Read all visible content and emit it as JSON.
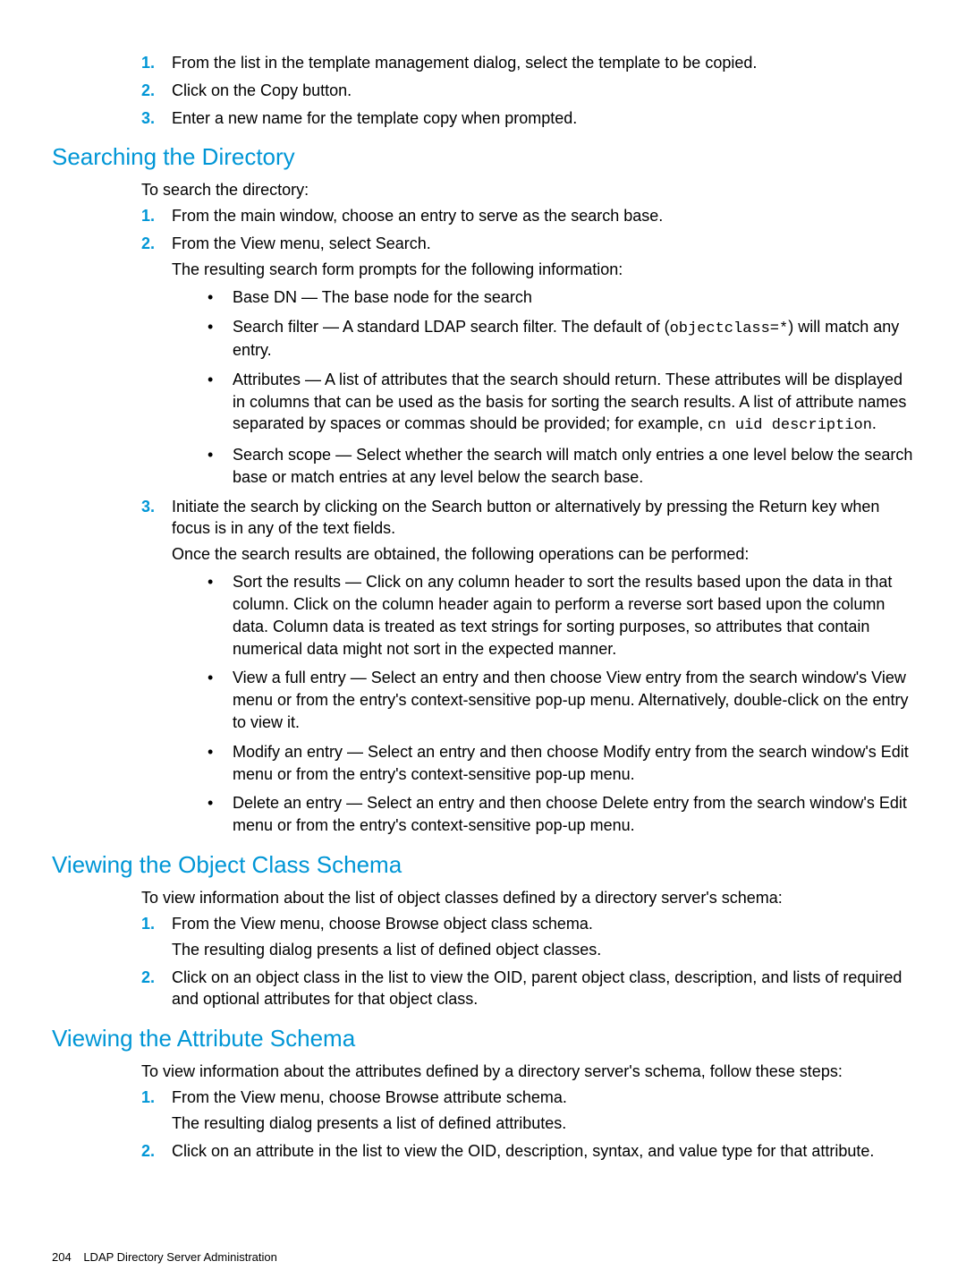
{
  "top_list": [
    {
      "n": "1.",
      "text": "From the list in the template management dialog, select the template to be copied."
    },
    {
      "n": "2.",
      "text": "Click on the Copy button."
    },
    {
      "n": "3.",
      "text": "Enter a new name for the template copy when prompted."
    }
  ],
  "s1": {
    "heading": "Searching the Directory",
    "intro": "To search the directory:",
    "items": [
      {
        "n": "1.",
        "text": "From the main window, choose an entry to serve as the search base."
      },
      {
        "n": "2.",
        "text": "From the View menu, select Search.",
        "after": "The resulting search form prompts for the following information:",
        "bullets": [
          {
            "pre": "Base DN — The base node for the search"
          },
          {
            "pre": "Search filter — A standard LDAP search filter. The default of (",
            "code": "objectclass=*",
            "post": ") will match any entry."
          },
          {
            "pre": "Attributes — A list of attributes that the search should return. These attributes will be displayed in columns that can be used as the basis for sorting the search results. A list of attribute names separated by spaces or commas should be provided; for example, ",
            "code": "cn uid description",
            "post": "."
          },
          {
            "pre": "Search scope — Select whether the search will match only entries a one level below the search base or match entries at any level below the search base."
          }
        ]
      },
      {
        "n": "3.",
        "text": "Initiate the search by clicking on the Search button or alternatively by pressing the Return key when focus is in any of the text fields.",
        "after": "Once the search results are obtained, the following operations can be performed:",
        "bullets": [
          {
            "pre": "Sort the results — Click on any column header to sort the results based upon the data in that column. Click on the column header again to perform a reverse sort based upon the column data. Column data is treated as text strings for sorting purposes, so attributes that contain numerical data might not sort in the expected manner."
          },
          {
            "pre": "View a full entry — Select an entry and then choose View entry from the search window's View menu or from the entry's context-sensitive pop-up menu. Alternatively, double-click on the entry to view it."
          },
          {
            "pre": "Modify an entry — Select an entry and then choose Modify entry from the search window's Edit menu or from the entry's context-sensitive pop-up menu."
          },
          {
            "pre": "Delete an entry — Select an entry and then choose Delete entry from the search window's Edit menu or from the entry's context-sensitive pop-up menu."
          }
        ]
      }
    ]
  },
  "s2": {
    "heading": "Viewing the Object Class Schema",
    "intro": "To view information about the list of object classes defined by a directory server's schema:",
    "items": [
      {
        "n": "1.",
        "text": "From the View menu, choose Browse object class schema.",
        "after": "The resulting dialog presents a list of defined object classes."
      },
      {
        "n": "2.",
        "text": "Click on an object class in the list to view the OID, parent object class, description, and lists of required and optional attributes for that object class."
      }
    ]
  },
  "s3": {
    "heading": "Viewing the Attribute Schema",
    "intro": "To view information about the attributes defined by a directory server's schema, follow these steps:",
    "items": [
      {
        "n": "1.",
        "text": "From the View menu, choose Browse attribute schema.",
        "after": "The resulting dialog presents a list of defined attributes."
      },
      {
        "n": "2.",
        "text": "Click on an attribute in the list to view the OID, description, syntax, and value type for that attribute."
      }
    ]
  },
  "footer": {
    "page": "204",
    "title": "LDAP Directory Server Administration"
  }
}
